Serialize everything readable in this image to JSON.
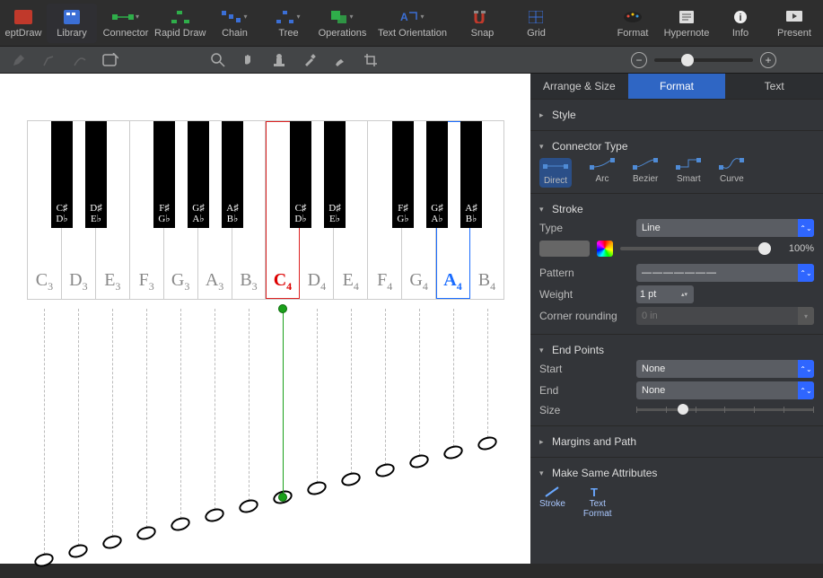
{
  "toolbar": {
    "items": [
      {
        "id": "conceptdraw",
        "label": "eptDraw"
      },
      {
        "id": "library",
        "label": "Library"
      },
      {
        "id": "connector",
        "label": "Connector"
      },
      {
        "id": "rapid-draw",
        "label": "Rapid Draw"
      },
      {
        "id": "chain",
        "label": "Chain"
      },
      {
        "id": "tree",
        "label": "Tree"
      },
      {
        "id": "operations",
        "label": "Operations"
      },
      {
        "id": "text-orientation",
        "label": "Text Orientation"
      },
      {
        "id": "snap",
        "label": "Snap"
      },
      {
        "id": "grid",
        "label": "Grid"
      }
    ],
    "right_items": [
      {
        "id": "format",
        "label": "Format"
      },
      {
        "id": "hypernote",
        "label": "Hypernote"
      },
      {
        "id": "info",
        "label": "Info"
      },
      {
        "id": "present",
        "label": "Present"
      }
    ]
  },
  "panel": {
    "tabs": [
      "Arrange & Size",
      "Format",
      "Text"
    ],
    "active_tab": "Format",
    "style_label": "Style",
    "connector_type_label": "Connector Type",
    "connector_types": [
      "Direct",
      "Arc",
      "Bezier",
      "Smart",
      "Curve"
    ],
    "stroke_label": "Stroke",
    "type_label": "Type",
    "type_value": "Line",
    "opacity_value": "100%",
    "pattern_label": "Pattern",
    "pattern_value": "———————",
    "weight_label": "Weight",
    "weight_value": "1 pt",
    "corner_label": "Corner rounding",
    "corner_value": "0 in",
    "endpoints_label": "End Points",
    "start_label": "Start",
    "start_value": "None",
    "end_label": "End",
    "end_value": "None",
    "size_label": "Size",
    "margins_label": "Margins and Path",
    "same_attr_label": "Make Same Attributes",
    "attr_items": [
      "Stroke",
      "Text Format"
    ]
  },
  "piano": {
    "white": [
      {
        "label": "C",
        "oct": "3"
      },
      {
        "label": "D",
        "oct": "3"
      },
      {
        "label": "E",
        "oct": "3"
      },
      {
        "label": "F",
        "oct": "3"
      },
      {
        "label": "G",
        "oct": "3"
      },
      {
        "label": "A",
        "oct": "3"
      },
      {
        "label": "B",
        "oct": "3"
      },
      {
        "label": "C",
        "oct": "4",
        "red": true
      },
      {
        "label": "D",
        "oct": "4"
      },
      {
        "label": "E",
        "oct": "4"
      },
      {
        "label": "F",
        "oct": "4"
      },
      {
        "label": "G",
        "oct": "4"
      },
      {
        "label": "A",
        "oct": "4",
        "blue": true
      },
      {
        "label": "B",
        "oct": "4"
      }
    ],
    "black": [
      {
        "pos": 0,
        "sharp": "C♯",
        "flat": "D♭"
      },
      {
        "pos": 1,
        "sharp": "D♯",
        "flat": "E♭"
      },
      {
        "pos": 3,
        "sharp": "F♯",
        "flat": "G♭"
      },
      {
        "pos": 4,
        "sharp": "G♯",
        "flat": "A♭"
      },
      {
        "pos": 5,
        "sharp": "A♯",
        "flat": "B♭"
      },
      {
        "pos": 7,
        "sharp": "C♯",
        "flat": "D♭"
      },
      {
        "pos": 8,
        "sharp": "D♯",
        "flat": "E♭"
      },
      {
        "pos": 10,
        "sharp": "F♯",
        "flat": "G♭"
      },
      {
        "pos": 11,
        "sharp": "G♯",
        "flat": "A♭"
      },
      {
        "pos": 12,
        "sharp": "A♯",
        "flat": "B♭"
      }
    ]
  }
}
